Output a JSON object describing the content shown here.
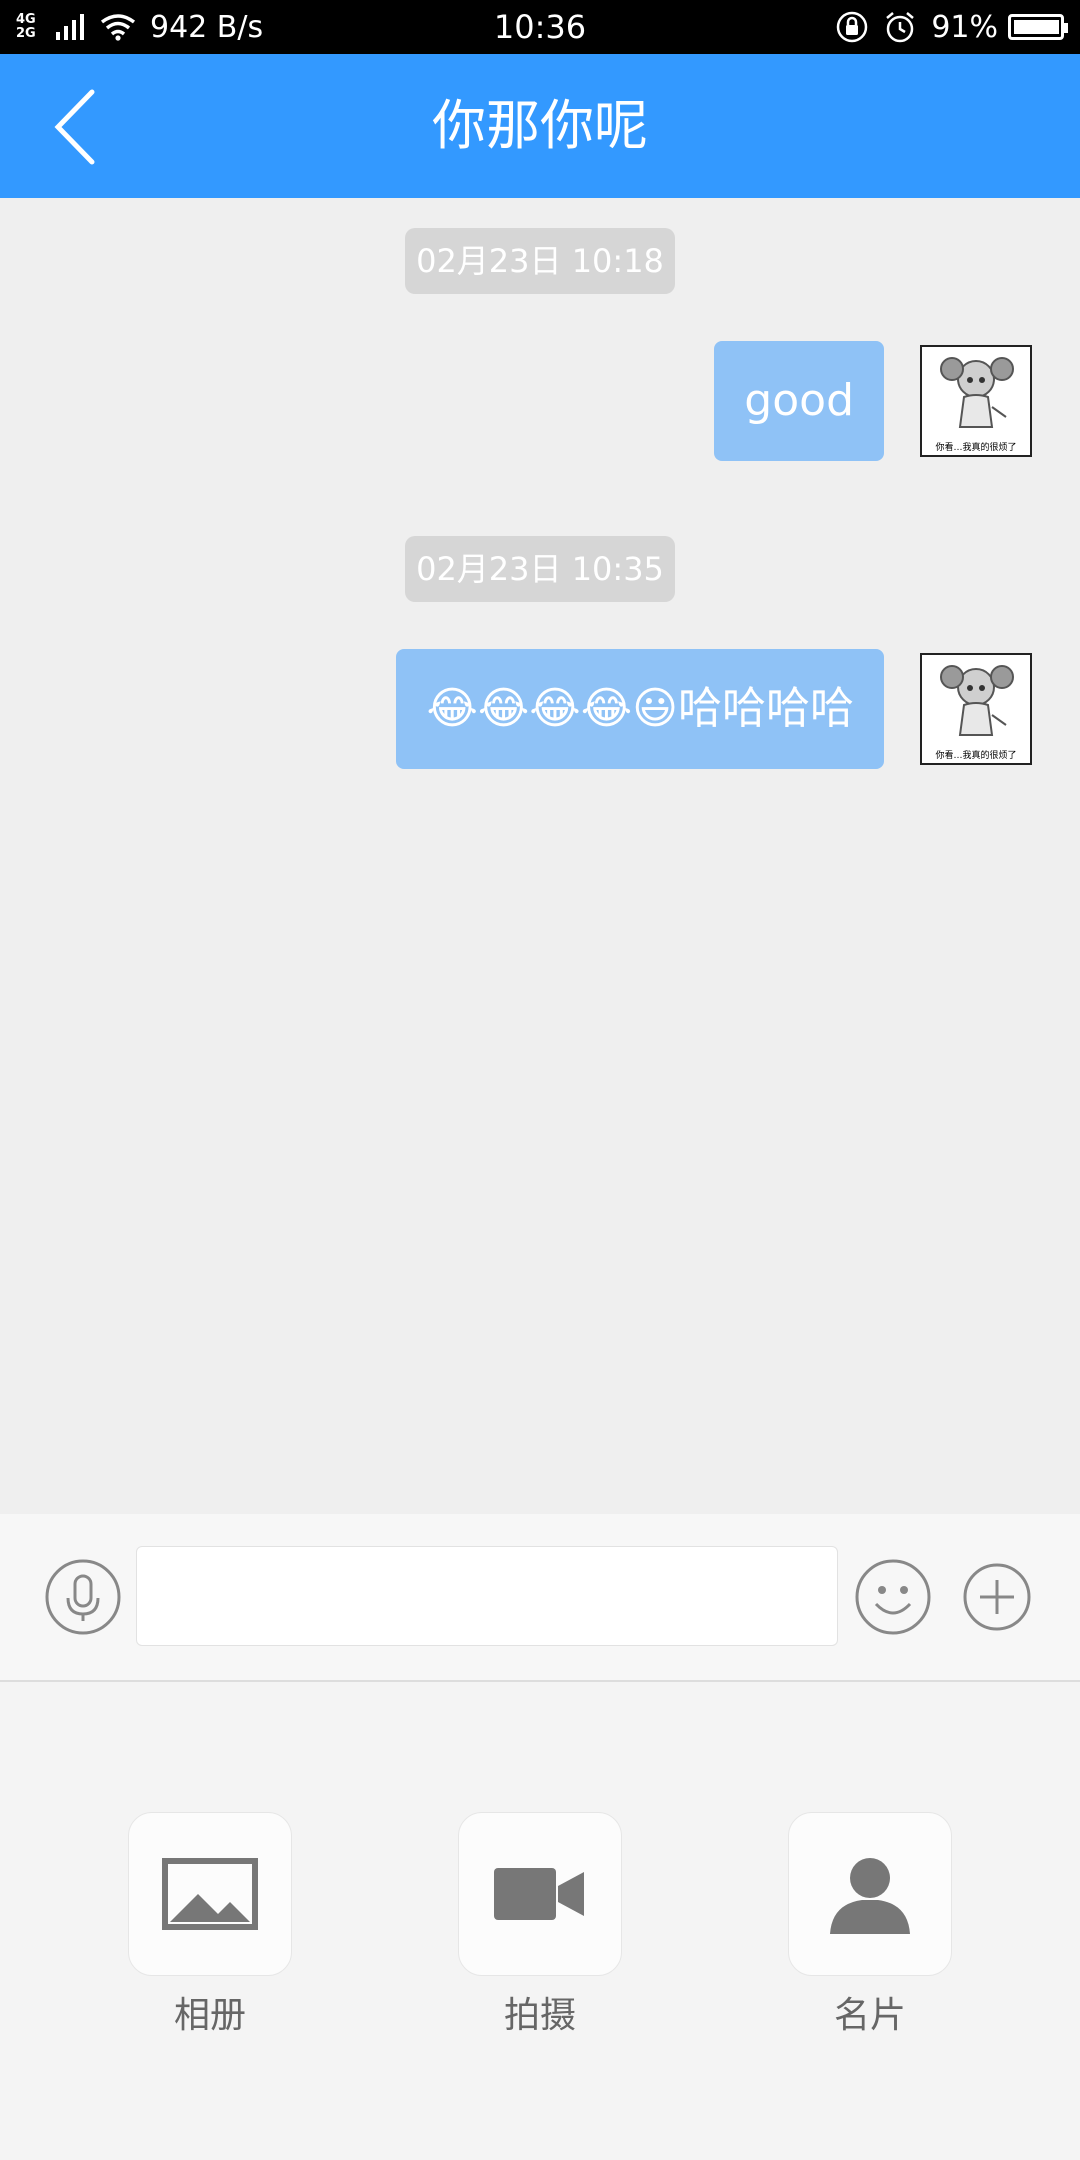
{
  "status_bar": {
    "network_type": "4G\n2G",
    "net_speed": "942 B/s",
    "time": "10:36",
    "battery": "91%",
    "battery_level": 0.91
  },
  "header": {
    "back_icon": "back-chevron-icon",
    "title": "你那你呢"
  },
  "messages": [
    {
      "timestamp": "02月23日 10:18",
      "text": "good",
      "outgoing": true
    },
    {
      "timestamp": "02月23日 10:35",
      "text": "😂😂😂😂😃哈哈哈哈",
      "outgoing": true
    }
  ],
  "avatar": {
    "caption": "你看…我真的很烦了"
  },
  "input_bar": {
    "voice_icon": "microphone-icon",
    "emoji_icon": "smiley-icon",
    "more_icon": "plus-icon",
    "placeholder": ""
  },
  "actions": [
    {
      "label": "相册",
      "icon": "image-icon"
    },
    {
      "label": "拍摄",
      "icon": "video-camera-icon"
    },
    {
      "label": "名片",
      "icon": "person-icon"
    }
  ],
  "colors": {
    "header_bg": "#3399ff",
    "bubble_bg": "#8fc2f6",
    "chat_bg": "#efefef",
    "timestamp_bg": "#d6d6d6"
  }
}
